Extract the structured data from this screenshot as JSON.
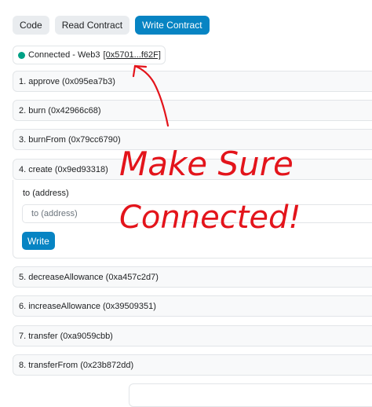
{
  "tabs": [
    {
      "label": "Code",
      "active": false
    },
    {
      "label": "Read Contract",
      "active": false
    },
    {
      "label": "Write Contract",
      "active": true
    }
  ],
  "connection": {
    "status_text": "Connected - Web3",
    "address": "[0x5701...f62F]",
    "status_color": "#00a186"
  },
  "functions": [
    {
      "label": "1. approve (0x095ea7b3)"
    },
    {
      "label": "2. burn (0x42966c68)"
    },
    {
      "label": "3. burnFrom (0x79cc6790)"
    },
    {
      "label": "4. create (0x9ed93318)"
    },
    {
      "label": "5. decreaseAllowance (0xa457c2d7)"
    },
    {
      "label": "6. increaseAllowance (0x39509351)"
    },
    {
      "label": "7. transfer (0xa9059cbb)"
    },
    {
      "label": "8. transferFrom (0x23b872dd)"
    }
  ],
  "create_form": {
    "param_label": "to (address)",
    "placeholder": "to (address)",
    "button_label": "Write"
  },
  "annotation": {
    "line1": "Make Sure",
    "line2": "Connected!",
    "color": "#e3141b"
  },
  "colors": {
    "accent": "#0784c3"
  }
}
